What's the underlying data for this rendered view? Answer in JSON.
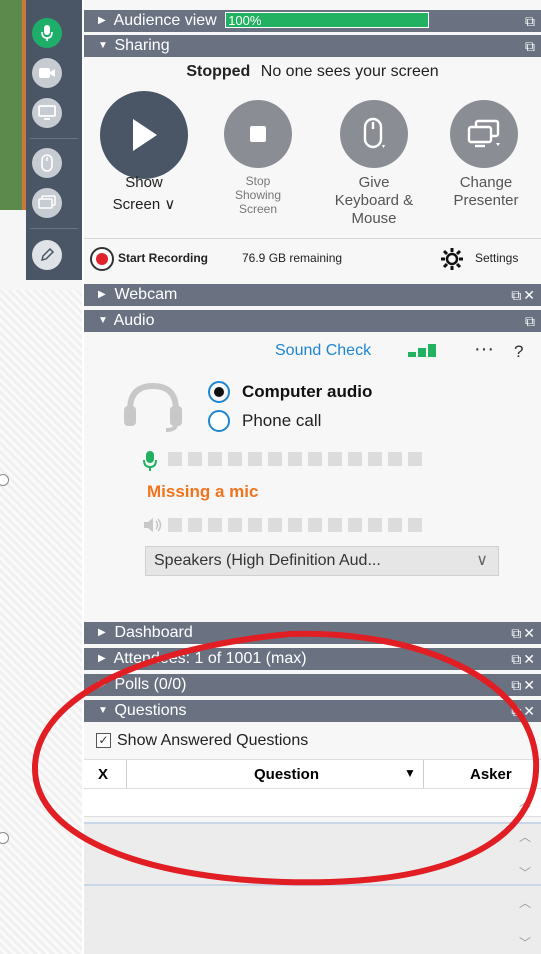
{
  "toolbar": {
    "icons": [
      "microphone-icon",
      "video-camera-icon",
      "monitor-icon",
      "mouse-icon",
      "presenter-icon",
      "pencil-icon"
    ]
  },
  "audience_view": {
    "label": "Audience view",
    "percent": "100%",
    "progress": 1.0
  },
  "sharing": {
    "title": "Sharing",
    "status_bold": "Stopped",
    "status_text": "No one sees your screen",
    "show": {
      "line1": "Show",
      "line2": "Screen",
      "chevron": "∨"
    },
    "stop": {
      "line1": "Stop",
      "line2": "Showing",
      "line3": "Screen"
    },
    "give": {
      "line1": "Give",
      "line2": "Keyboard &",
      "line3": "Mouse"
    },
    "change": {
      "line1": "Change",
      "line2": "Presenter"
    },
    "recording": {
      "label": "Start Recording",
      "remaining": "76.9 GB remaining",
      "settings": "Settings"
    }
  },
  "webcam": {
    "title": "Webcam"
  },
  "audio": {
    "title": "Audio",
    "sound_check": "Sound Check",
    "more": "···",
    "help": "?",
    "computer_audio": "Computer audio",
    "phone_call": "Phone call",
    "missing_mic": "Missing a mic",
    "speaker_select": "Speakers (High Definition Aud...",
    "mic_level_segments": 13,
    "speaker_level_segments": 13
  },
  "dashboard": {
    "title": "Dashboard"
  },
  "attendees": {
    "title": "Attendees:  1 of 1001 (max)"
  },
  "polls": {
    "title": "Polls (0/0)"
  },
  "questions": {
    "title": "Questions",
    "show_answered": "Show Answered Questions",
    "col_x": "X",
    "col_question": "Question",
    "col_asker": "Asker"
  },
  "colors": {
    "header": "#6a7282",
    "accent_green": "#22b160",
    "toolbar": "#4a5566",
    "warning": "#f0731e",
    "link": "#1e86d2",
    "annotation": "#e01e24"
  }
}
